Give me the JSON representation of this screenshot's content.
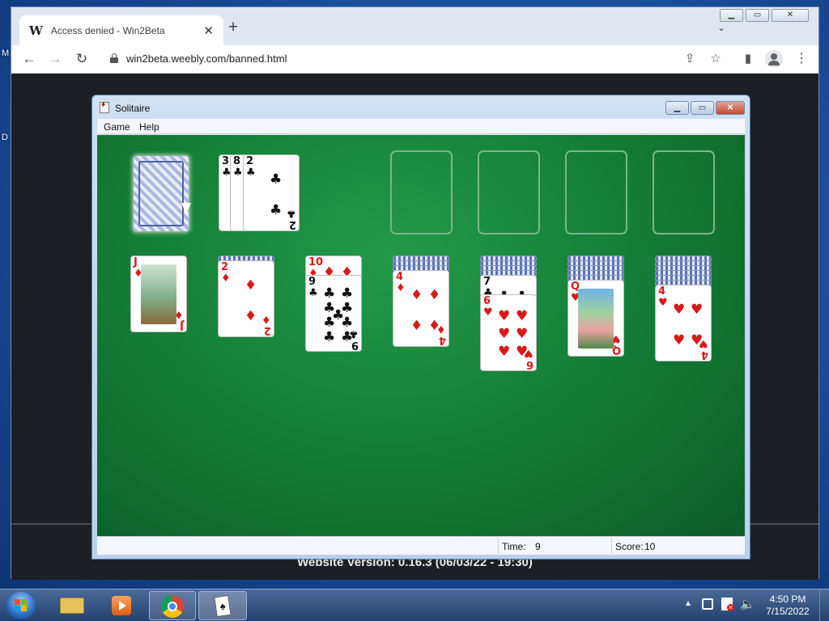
{
  "browser": {
    "tab_title": "Access denied - Win2Beta",
    "tab_logo": "W",
    "new_tab": "+",
    "url": "win2beta.weebly.com/banned.html",
    "window_controls": [
      "minimize",
      "maximize",
      "close"
    ],
    "page_footer": "Website Version: 0.16.3 (06/03/22 - 19:30)"
  },
  "desktop": {
    "edge_letters": [
      "M",
      "D"
    ]
  },
  "solitaire": {
    "title": "Solitaire",
    "menu": [
      "Game",
      "Help"
    ],
    "status": {
      "time_label": "Time:",
      "time_value": "9",
      "score_label": "Score:",
      "score_value": "10"
    },
    "stock": "face-down",
    "waste": [
      {
        "rank": "3",
        "suit": "♣",
        "color": "black"
      },
      {
        "rank": "8",
        "suit": "♣",
        "color": "black"
      },
      {
        "rank": "2",
        "suit": "♣",
        "color": "black"
      }
    ],
    "foundations": [
      "empty",
      "empty",
      "empty",
      "empty"
    ],
    "tableau": [
      {
        "hidden": 0,
        "cards": [
          {
            "rank": "J",
            "suit": "♦",
            "color": "red"
          }
        ]
      },
      {
        "hidden": 1,
        "cards": [
          {
            "rank": "2",
            "suit": "♦",
            "color": "red"
          }
        ]
      },
      {
        "hidden": 0,
        "cards": [
          {
            "rank": "10",
            "suit": "♦",
            "color": "red"
          },
          {
            "rank": "9",
            "suit": "♣",
            "color": "black"
          }
        ]
      },
      {
        "hidden": 3,
        "cards": [
          {
            "rank": "4",
            "suit": "♦",
            "color": "red"
          }
        ]
      },
      {
        "hidden": 4,
        "cards": [
          {
            "rank": "7",
            "suit": "♣",
            "color": "black"
          },
          {
            "rank": "6",
            "suit": "♥",
            "color": "red"
          }
        ]
      },
      {
        "hidden": 5,
        "cards": [
          {
            "rank": "Q",
            "suit": "♥",
            "color": "red"
          }
        ]
      },
      {
        "hidden": 6,
        "cards": [
          {
            "rank": "4",
            "suit": "♥",
            "color": "red"
          }
        ]
      }
    ]
  },
  "taskbar": {
    "time": "4:50 PM",
    "date": "7/15/2022",
    "apps": [
      "start-orb",
      "file-explorer",
      "media-player",
      "chrome",
      "solitaire"
    ]
  }
}
